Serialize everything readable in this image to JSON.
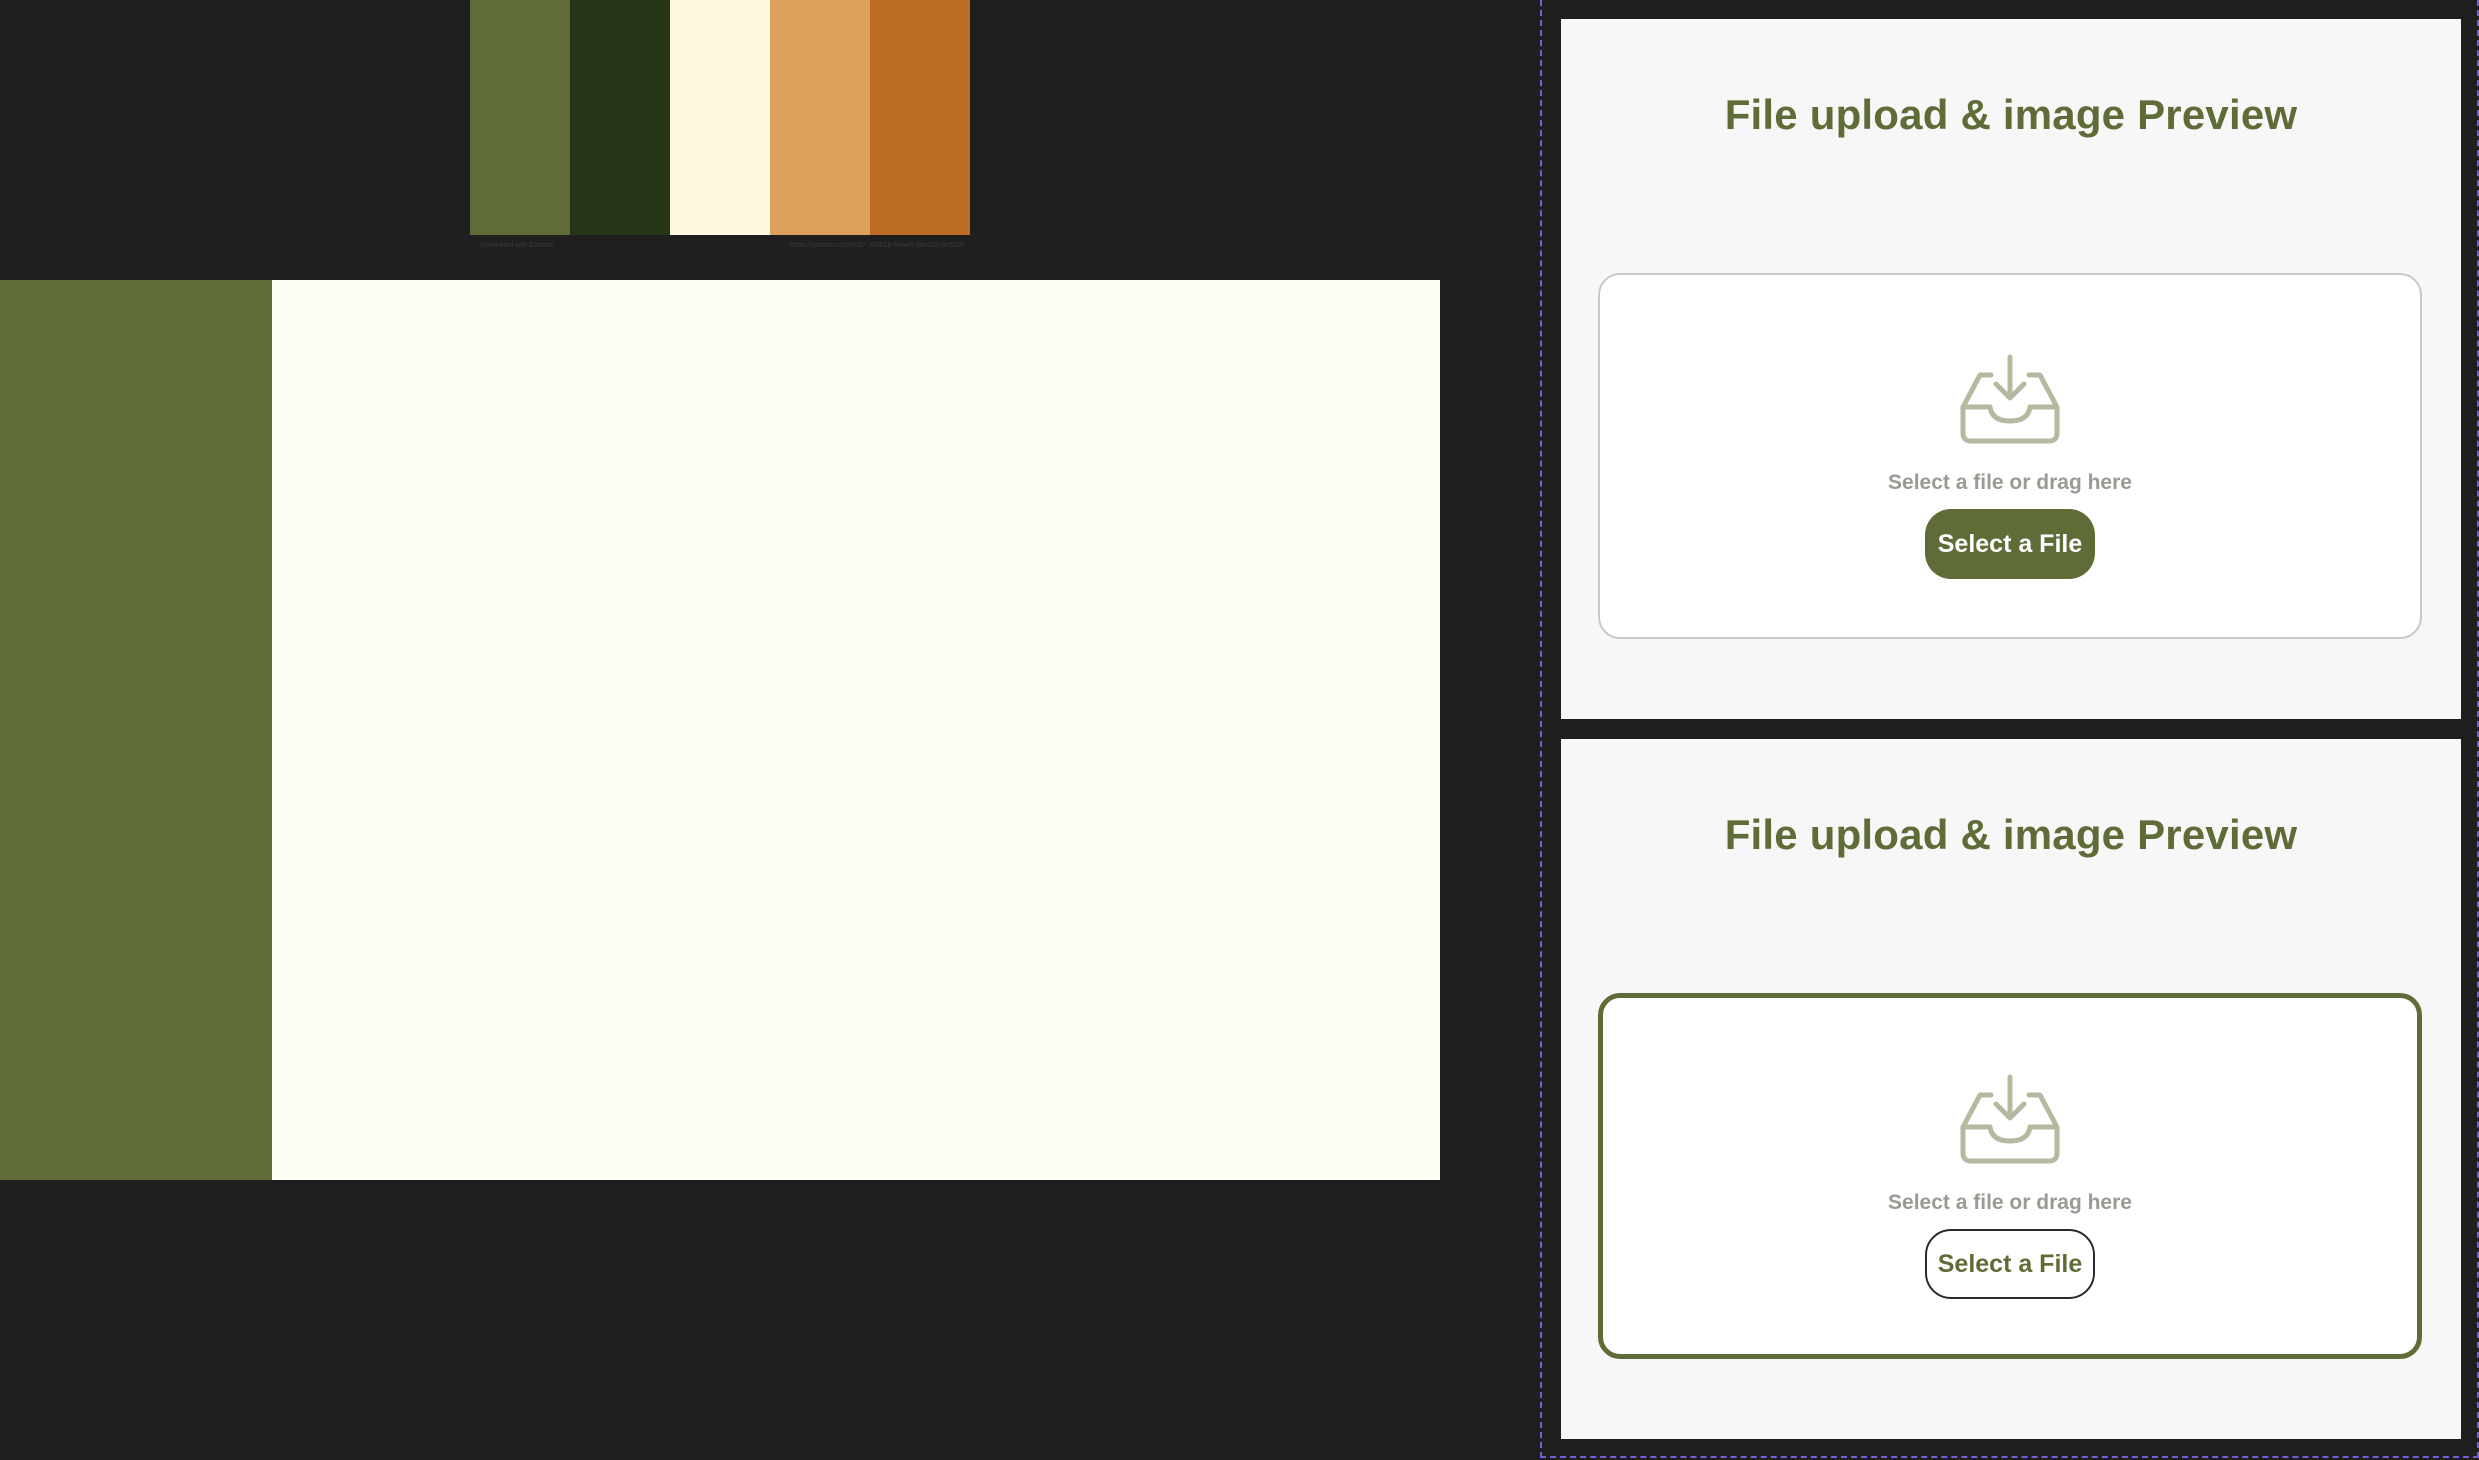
{
  "palette": {
    "colors": [
      "#5f6c37",
      "#283618",
      "#fefae0",
      "#dda15e",
      "#bc6c25"
    ],
    "caption_left": "Generated with Coolors",
    "caption_right": "https://coolors.co/5f6c37-283618-fefae0-dda15e-bc6c25"
  },
  "mock_app": {
    "sidebar_color": "#5f6c37",
    "main_color": "#fdfdf3"
  },
  "cards": [
    {
      "title": "File upload & image Preview",
      "icon": "inbox-download-icon",
      "hint": "Select a file or drag here",
      "button_label": "Select a File",
      "state": "default"
    },
    {
      "title": "File upload & image Preview",
      "icon": "inbox-download-icon",
      "hint": "Select a file or drag here",
      "button_label": "Select a File",
      "state": "drag-active"
    }
  ],
  "colors": {
    "accent": "#5f6c37",
    "icon": "#b4b9a0",
    "hint_text": "#9a9a92",
    "frame_outline": "#7b5cd6"
  }
}
